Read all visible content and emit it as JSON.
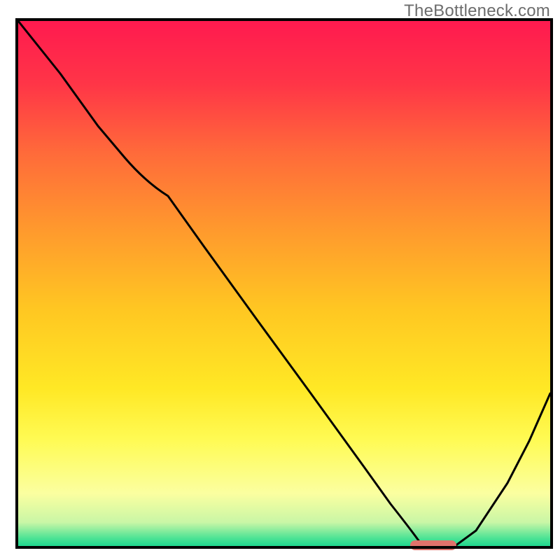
{
  "watermark": "TheBottleneck.com",
  "chart_data": {
    "type": "line",
    "title": "",
    "xlabel": "",
    "ylabel": "",
    "xlim": [
      0,
      100
    ],
    "ylim": [
      0,
      100
    ],
    "note": "No axis labels or numeric tick marks are rendered in the image; data below estimated from pixel positions relative to the inner plot rectangle (spanning roughly x:25-785, y:30-780). Y-values are percentage from bottom (0) to top (100).",
    "series": [
      {
        "name": "black-curve",
        "x": [
          0,
          8,
          15,
          20,
          24,
          28,
          35,
          45,
          55,
          65,
          70,
          74,
          78,
          82,
          86,
          92,
          96,
          100
        ],
        "values": [
          100,
          90,
          80,
          74,
          70,
          67,
          57,
          43,
          29,
          15,
          8,
          3,
          0,
          0,
          3,
          12,
          20,
          29
        ]
      }
    ],
    "gradient_stops": [
      {
        "offset": 0.0,
        "color": "#ff1a4f"
      },
      {
        "offset": 0.12,
        "color": "#ff3547"
      },
      {
        "offset": 0.25,
        "color": "#ff6a3a"
      },
      {
        "offset": 0.4,
        "color": "#ff9a2d"
      },
      {
        "offset": 0.55,
        "color": "#ffc722"
      },
      {
        "offset": 0.7,
        "color": "#ffe825"
      },
      {
        "offset": 0.8,
        "color": "#fffb55"
      },
      {
        "offset": 0.9,
        "color": "#fbffa0"
      },
      {
        "offset": 0.955,
        "color": "#c9f6a6"
      },
      {
        "offset": 0.985,
        "color": "#4de395"
      },
      {
        "offset": 1.0,
        "color": "#1fd88f"
      }
    ],
    "marker": {
      "name": "optimal-segment",
      "x_start": 74,
      "x_end": 82,
      "y": 0,
      "color": "#e0726b"
    },
    "frame_color": "#000000",
    "frame_width": 4
  }
}
